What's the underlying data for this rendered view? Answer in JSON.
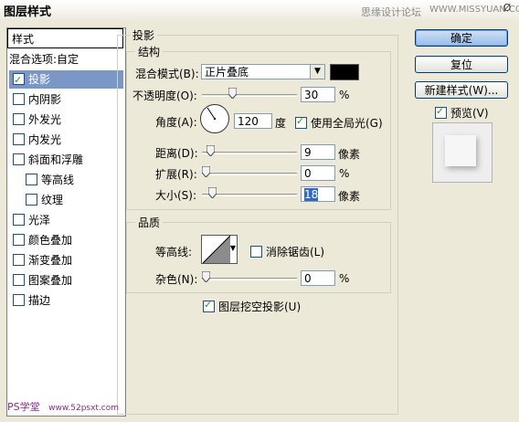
{
  "window": {
    "title": "图层样式",
    "watermark": "思缘设计论坛",
    "watermark_url": "WWW.MISSYUAN.COM",
    "close_glyph": "Ø"
  },
  "styles_panel": {
    "header": "样式",
    "items": [
      {
        "label": "混合选项:自定",
        "has_checkbox": false,
        "checked": false,
        "selected": false,
        "indent": false
      },
      {
        "label": "投影",
        "has_checkbox": true,
        "checked": true,
        "selected": true,
        "indent": false
      },
      {
        "label": "内阴影",
        "has_checkbox": true,
        "checked": false,
        "selected": false,
        "indent": false
      },
      {
        "label": "外发光",
        "has_checkbox": true,
        "checked": false,
        "selected": false,
        "indent": false
      },
      {
        "label": "内发光",
        "has_checkbox": true,
        "checked": false,
        "selected": false,
        "indent": false
      },
      {
        "label": "斜面和浮雕",
        "has_checkbox": true,
        "checked": false,
        "selected": false,
        "indent": false
      },
      {
        "label": "等高线",
        "has_checkbox": true,
        "checked": false,
        "selected": false,
        "indent": true
      },
      {
        "label": "纹理",
        "has_checkbox": true,
        "checked": false,
        "selected": false,
        "indent": true
      },
      {
        "label": "光泽",
        "has_checkbox": true,
        "checked": false,
        "selected": false,
        "indent": false
      },
      {
        "label": "颜色叠加",
        "has_checkbox": true,
        "checked": false,
        "selected": false,
        "indent": false
      },
      {
        "label": "渐变叠加",
        "has_checkbox": true,
        "checked": false,
        "selected": false,
        "indent": false
      },
      {
        "label": "图案叠加",
        "has_checkbox": true,
        "checked": false,
        "selected": false,
        "indent": false
      },
      {
        "label": "描边",
        "has_checkbox": true,
        "checked": false,
        "selected": false,
        "indent": false
      }
    ]
  },
  "drop_shadow": {
    "title": "投影",
    "structure": {
      "title": "结构",
      "blend_mode_label": "混合模式(B):",
      "blend_mode_value": "正片叠底",
      "shadow_color": "#000000",
      "opacity_label": "不透明度(O):",
      "opacity_value": "30",
      "opacity_unit": "%",
      "opacity_fraction": 0.3,
      "angle_label": "角度(A):",
      "angle_value": "120",
      "angle_unit": "度",
      "global_light_label": "使用全局光(G)",
      "global_light_checked": true,
      "distance_label": "距离(D):",
      "distance_value": "9",
      "distance_unit": "像素",
      "distance_fraction": 0.05,
      "spread_label": "扩展(R):",
      "spread_value": "0",
      "spread_unit": "%",
      "spread_fraction": 0,
      "size_label": "大小(S):",
      "size_value": "18",
      "size_unit": "像素",
      "size_fraction": 0.07
    },
    "quality": {
      "title": "品质",
      "contour_label": "等高线:",
      "antialias_label": "消除锯齿(L)",
      "antialias_checked": false,
      "noise_label": "杂色(N):",
      "noise_value": "0",
      "noise_unit": "%",
      "noise_fraction": 0
    },
    "knockout_label": "图层挖空投影(U)",
    "knockout_checked": true
  },
  "buttons": {
    "ok": "确定",
    "reset": "复位",
    "new_style": "新建样式(W)...",
    "preview_label": "预览(V)",
    "preview_checked": true
  },
  "footer": {
    "brand": "PS学堂",
    "url": "www.52psxt.com"
  }
}
